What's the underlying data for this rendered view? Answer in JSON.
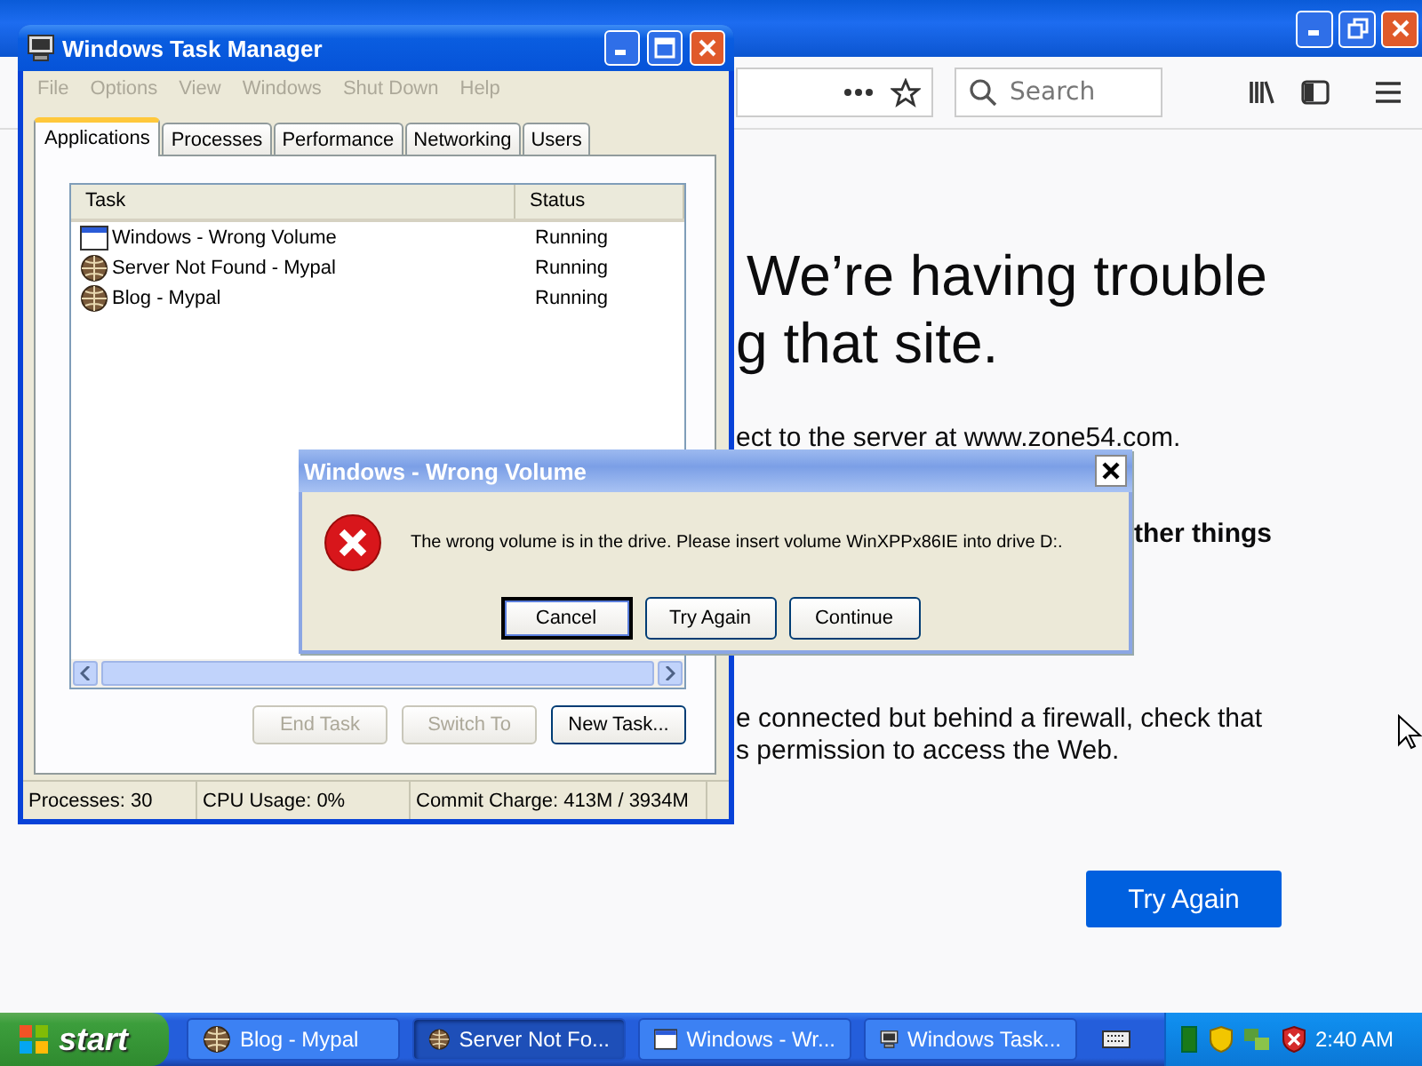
{
  "browser": {
    "toolbar": {
      "search": {
        "placeholder": "Search"
      }
    },
    "content": {
      "heading": [
        "We’re having trouble",
        "g that site."
      ],
      "server_line": "ect to the server at www.zone54.com.",
      "subheading": "ther things",
      "advice": [
        "e connected but behind a firewall, check that",
        "s permission to access the Web."
      ],
      "button": "Try Again"
    }
  },
  "task_manager": {
    "title": "Windows Task Manager",
    "menu": [
      {
        "label": "File",
        "disabled": true
      },
      {
        "label": "Options",
        "disabled": true
      },
      {
        "label": "View",
        "disabled": true
      },
      {
        "label": "Windows",
        "disabled": true
      },
      {
        "label": "Shut Down",
        "disabled": true
      },
      {
        "label": "Help",
        "disabled": true
      }
    ],
    "tabs": [
      {
        "label": "Applications",
        "selected": true
      },
      {
        "label": "Processes",
        "selected": false
      },
      {
        "label": "Performance",
        "selected": false
      },
      {
        "label": "Networking",
        "selected": false
      },
      {
        "label": "Users",
        "selected": false
      }
    ],
    "columns": [
      "Task",
      "Status"
    ],
    "rows": [
      {
        "kind": "window",
        "task": "Windows - Wrong Volume",
        "status": "Running"
      },
      {
        "kind": "browser",
        "task": "Server Not Found - Mypal",
        "status": "Running"
      },
      {
        "kind": "browser",
        "task": "Blog - Mypal",
        "status": "Running"
      }
    ],
    "buttons": [
      {
        "label": "End Task",
        "disabled": true
      },
      {
        "label": "Switch To",
        "disabled": true
      },
      {
        "label": "New Task...",
        "disabled": false
      }
    ],
    "status_bar": [
      "Processes: 30",
      "CPU Usage: 0%",
      "Commit Charge: 413M / 3934M"
    ]
  },
  "dialog": {
    "title": "Windows - Wrong Volume",
    "message": "The wrong volume is in the drive. Please insert volume WinXPPx86IE into drive D:.",
    "buttons": [
      {
        "label": "Cancel",
        "default": true
      },
      {
        "label": "Try Again",
        "default": false
      },
      {
        "label": "Continue",
        "default": false
      }
    ]
  },
  "taskbar": {
    "start": "start",
    "tasks": [
      {
        "kind": "browser",
        "label": "Blog - Mypal",
        "selected": false
      },
      {
        "kind": "browser",
        "label": "Server Not Fo...",
        "selected": true
      },
      {
        "kind": "window",
        "label": "Windows - Wr...",
        "selected": false
      },
      {
        "kind": "taskmgr",
        "label": "Windows Task...",
        "selected": false
      }
    ],
    "clock": "2:40 AM"
  }
}
